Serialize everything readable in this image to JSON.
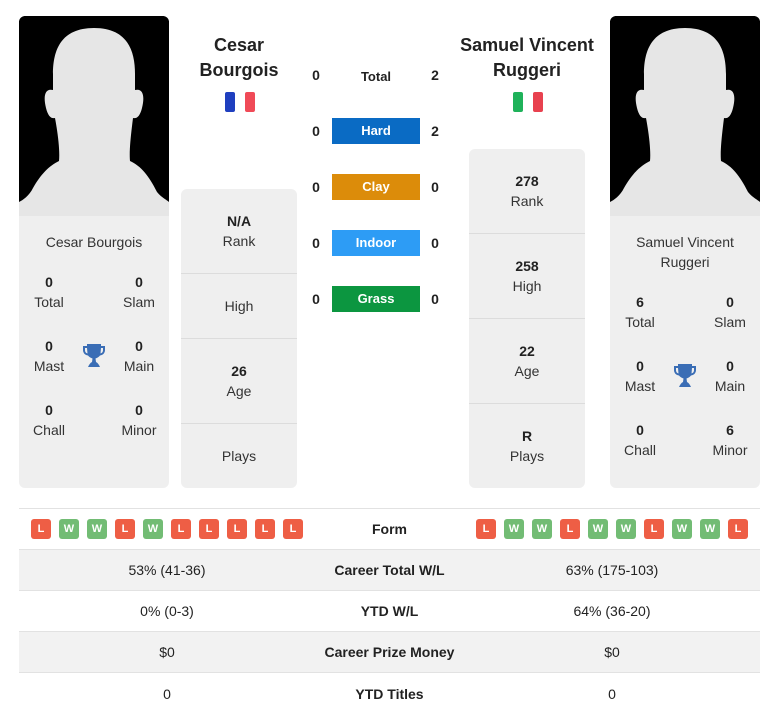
{
  "player1": {
    "name": "Cesar Bourgois",
    "name_line1": "Cesar",
    "name_line2": "Bourgois",
    "flag_colors": [
      "#1f3fbf",
      "#f04a57"
    ],
    "card_name": "Cesar Bourgois",
    "titles": {
      "total": {
        "value": "0",
        "label": "Total"
      },
      "slam": {
        "value": "0",
        "label": "Slam"
      },
      "mast": {
        "value": "0",
        "label": "Mast"
      },
      "main": {
        "value": "0",
        "label": "Main"
      },
      "chall": {
        "value": "0",
        "label": "Chall"
      },
      "minor": {
        "value": "0",
        "label": "Minor"
      }
    },
    "stats": [
      {
        "value": "N/A",
        "label": "Rank"
      },
      {
        "value": "",
        "label": "High"
      },
      {
        "value": "26",
        "label": "Age"
      },
      {
        "value": "",
        "label": "Plays"
      }
    ],
    "form": [
      "L",
      "W",
      "W",
      "L",
      "W",
      "L",
      "L",
      "L",
      "L",
      "L"
    ]
  },
  "player2": {
    "name": "Samuel Vincent Ruggeri",
    "name_line1": "Samuel Vincent",
    "name_line2": "Ruggeri",
    "flag_colors": [
      "#1fb25a",
      "#e8414f"
    ],
    "card_name_line1": "Samuel Vincent",
    "card_name_line2": "Ruggeri",
    "titles": {
      "total": {
        "value": "6",
        "label": "Total"
      },
      "slam": {
        "value": "0",
        "label": "Slam"
      },
      "mast": {
        "value": "0",
        "label": "Mast"
      },
      "main": {
        "value": "0",
        "label": "Main"
      },
      "chall": {
        "value": "0",
        "label": "Chall"
      },
      "minor": {
        "value": "6",
        "label": "Minor"
      }
    },
    "stats": [
      {
        "value": "278",
        "label": "Rank"
      },
      {
        "value": "258",
        "label": "High"
      },
      {
        "value": "22",
        "label": "Age"
      },
      {
        "value": "R",
        "label": "Plays"
      }
    ],
    "form": [
      "L",
      "W",
      "W",
      "L",
      "W",
      "W",
      "L",
      "W",
      "W",
      "L"
    ]
  },
  "surfaces": [
    {
      "label": "Total",
      "p1": "0",
      "p2": "2",
      "color": ""
    },
    {
      "label": "Hard",
      "p1": "0",
      "p2": "2",
      "color": "#0a6bc4"
    },
    {
      "label": "Clay",
      "p1": "0",
      "p2": "0",
      "color": "#dc8c0a"
    },
    {
      "label": "Indoor",
      "p1": "0",
      "p2": "0",
      "color": "#2d9cf5"
    },
    {
      "label": "Grass",
      "p1": "0",
      "p2": "0",
      "color": "#0c9640"
    }
  ],
  "comparison": {
    "form_label": "Form",
    "rows": [
      {
        "label": "Career Total W/L",
        "p1": "53% (41-36)",
        "p2": "63% (175-103)"
      },
      {
        "label": "YTD W/L",
        "p1": "0% (0-3)",
        "p2": "64% (36-20)"
      },
      {
        "label": "Career Prize Money",
        "p1": "$0",
        "p2": "$0"
      },
      {
        "label": "YTD Titles",
        "p1": "0",
        "p2": "0"
      }
    ]
  },
  "colors": {
    "loss": "#ee5e45",
    "win": "#72bc74",
    "trophy": "#3a6db5"
  }
}
